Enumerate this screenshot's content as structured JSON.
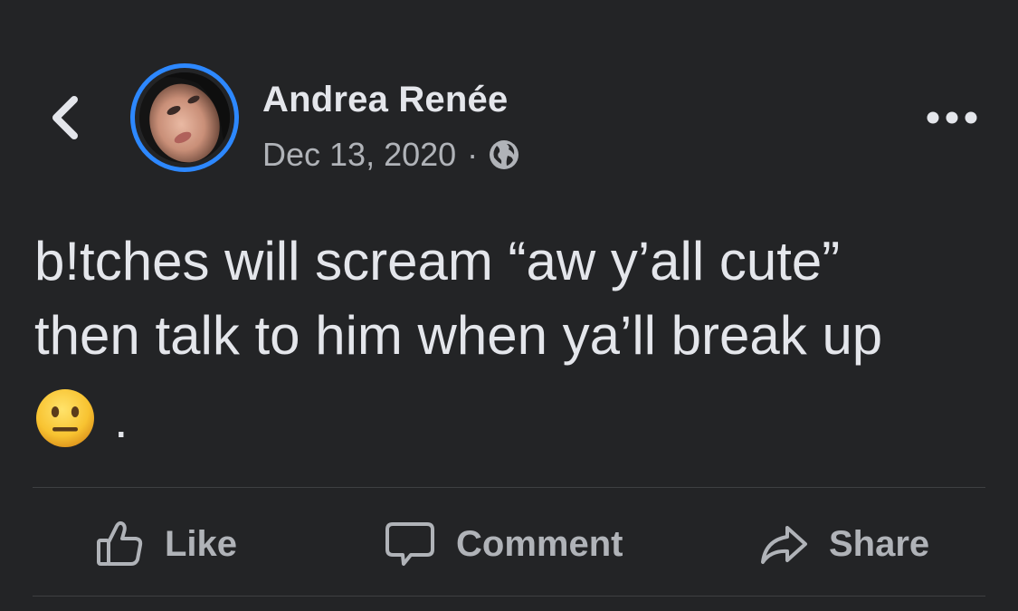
{
  "post": {
    "author": "Andrea Renée",
    "date": "Dec 13, 2020",
    "separator": "·",
    "audience_icon": "globe-icon",
    "text_line1": "b!tches will scream “aw y’all cute”",
    "text_line2": "then talk to him when ya’ll break up",
    "emoji": "neutral-face-emoji",
    "trailing_text": "."
  },
  "header": {
    "back_icon": "chevron-left-icon",
    "more_icon": "more-horizontal-icon"
  },
  "actions": {
    "like_label": "Like",
    "comment_label": "Comment",
    "share_label": "Share"
  },
  "colors": {
    "background": "#232426",
    "primary_text": "#e4e6eb",
    "secondary_text": "#b0b3b8",
    "avatar_ring": "#2d88ff",
    "divider": "#3e4042"
  }
}
